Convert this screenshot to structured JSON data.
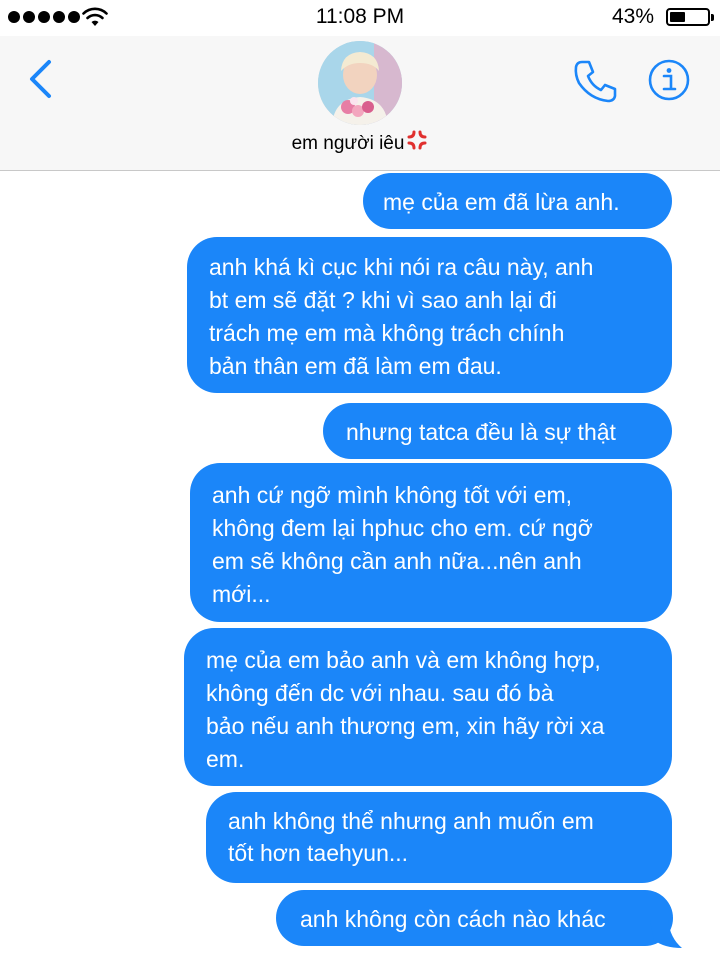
{
  "status_bar": {
    "time": "11:08 PM",
    "battery_percent_label": "43%",
    "battery_level": 0.43
  },
  "header": {
    "contact_name": "em người iêu",
    "contact_emoji": "anger-symbol-icon",
    "back_icon": "chevron-left-icon",
    "call_icon": "phone-icon",
    "info_icon": "info-icon"
  },
  "colors": {
    "accent": "#1b86f9",
    "bubble_text": "#ffffff",
    "emoji_red": "#e0302e"
  },
  "messages": [
    {
      "sender": "me",
      "text": "mẹ của em đã lừa anh."
    },
    {
      "sender": "me",
      "text": "anh khá kì cục khi nói ra câu này, anh\nbt em sẽ đặt ? khi vì sao anh lại đi\ntrách mẹ em mà không trách chính\nbản thân em đã làm em đau."
    },
    {
      "sender": "me",
      "text": "nhưng tatca đều là sự thật"
    },
    {
      "sender": "me",
      "text": "anh cứ ngỡ mình không tốt với em,\nkhông đem lại hphuc cho em. cứ ngỡ\nem sẽ không cần anh nữa...nên anh\nmới..."
    },
    {
      "sender": "me",
      "text": "mẹ của em bảo anh và em không hợp,\nkhông đến dc với nhau. sau đó bà\nbảo nếu anh thương em, xin hãy rời xa\nem."
    },
    {
      "sender": "me",
      "text": "anh không thể nhưng anh muốn em\ntốt hơn taehyun..."
    },
    {
      "sender": "me",
      "text": "anh không còn cách nào khác"
    }
  ]
}
